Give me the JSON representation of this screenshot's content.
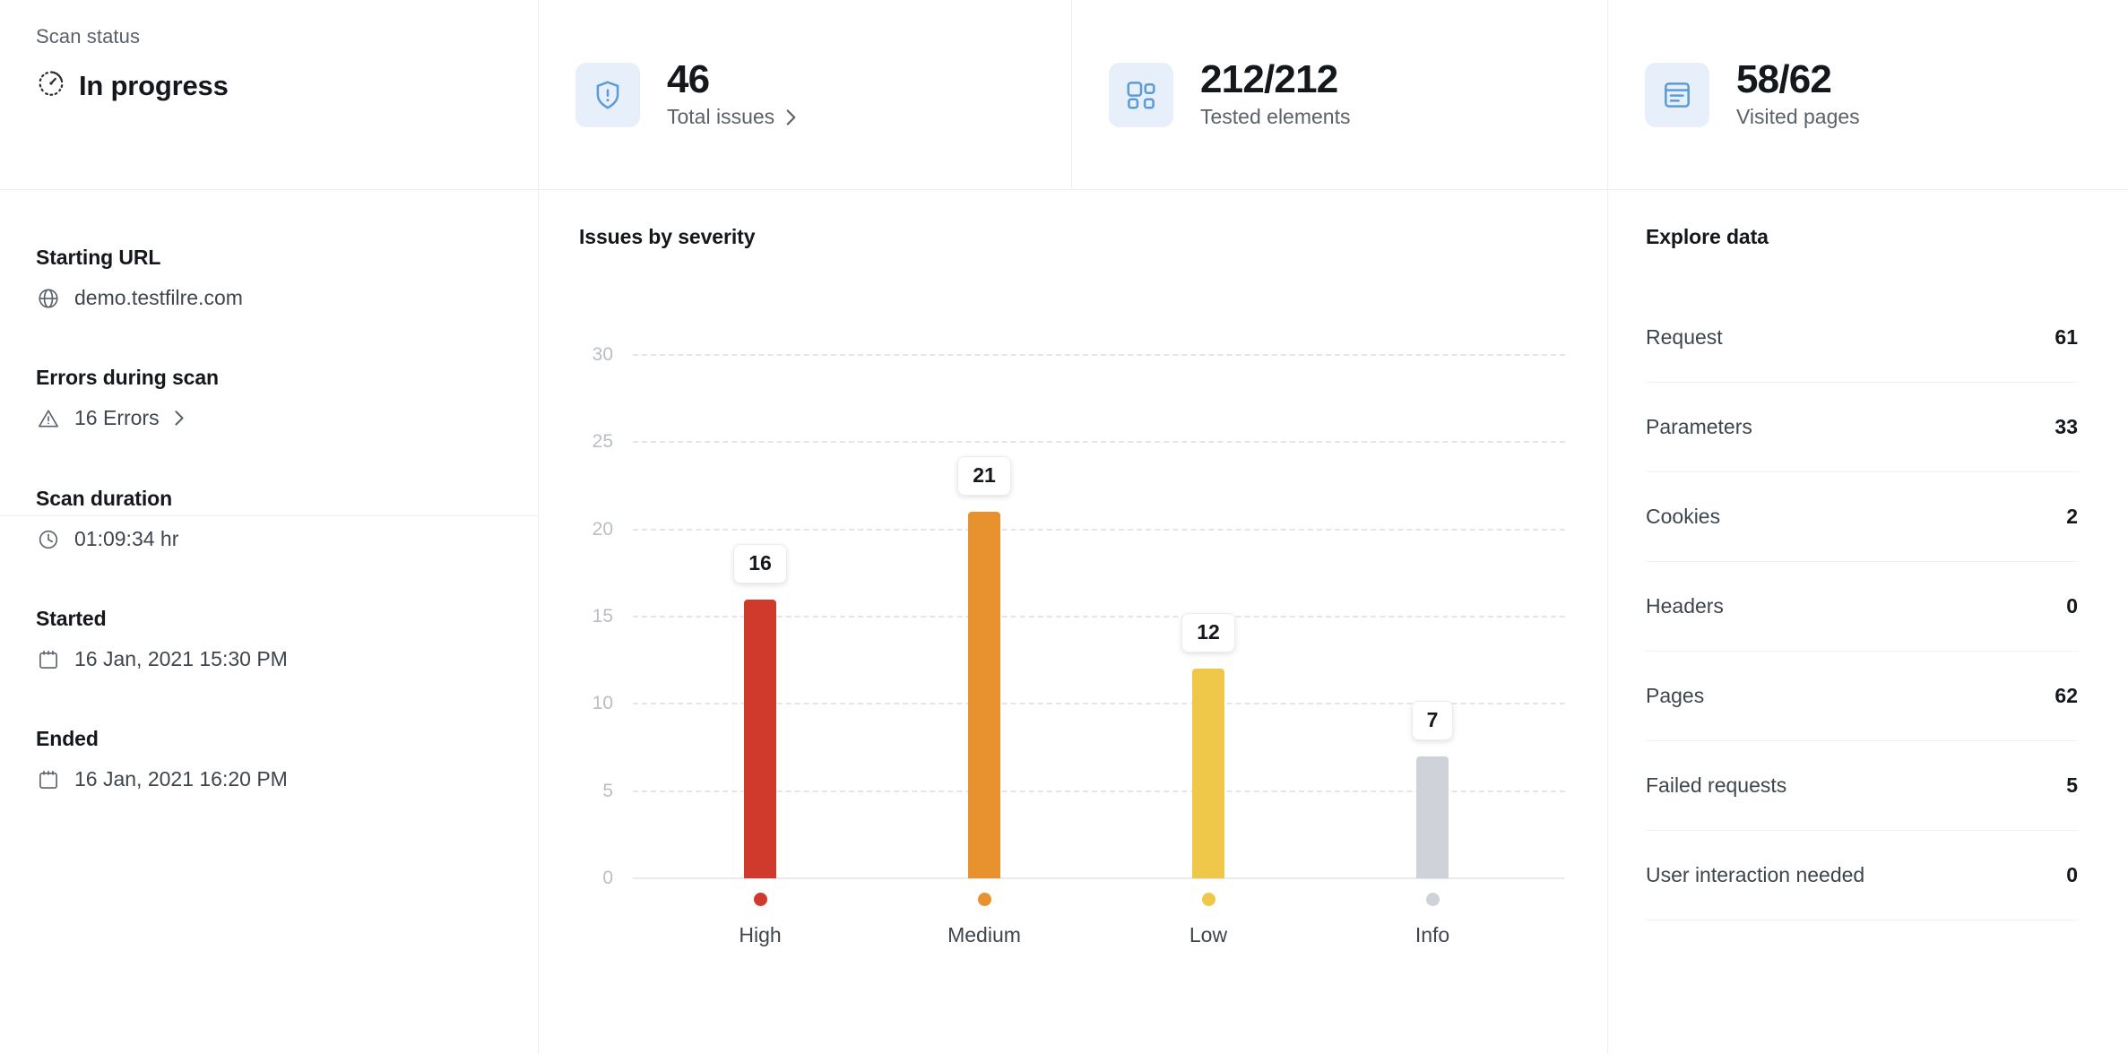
{
  "status_card": {
    "label": "Scan status",
    "value": "In progress",
    "icon": "gauge-in-progress-icon"
  },
  "stat_cards": [
    {
      "icon": "shield-alert-icon",
      "value": "46",
      "caption": "Total issues",
      "has_chevron": true
    },
    {
      "icon": "elements-blocks-icon",
      "value": "212/212",
      "caption": "Tested elements",
      "has_chevron": false
    },
    {
      "icon": "page-document-icon",
      "value": "58/62",
      "caption": "Visited pages",
      "has_chevron": false
    }
  ],
  "sidebar": {
    "groups": [
      {
        "blocks": [
          {
            "title": "Starting URL",
            "icon": "globe-icon",
            "value": "demo.testfilre.com",
            "has_chevron": false
          },
          {
            "title": "Errors during scan",
            "icon": "warning-triangle-icon",
            "value": "16 Errors",
            "has_chevron": true
          }
        ]
      },
      {
        "blocks": [
          {
            "title": "Scan duration",
            "icon": "clock-icon",
            "value": "01:09:34 hr",
            "has_chevron": false
          },
          {
            "title": "Started",
            "icon": "calendar-icon",
            "value": "16 Jan, 2021 15:30 PM",
            "has_chevron": false
          },
          {
            "title": "Ended",
            "icon": "calendar-icon",
            "value": "16 Jan, 2021 16:20 PM",
            "has_chevron": false
          }
        ]
      }
    ]
  },
  "chart_data": {
    "type": "bar",
    "title": "Issues by severity",
    "xlabel": "",
    "ylabel": "",
    "categories": [
      "High",
      "Medium",
      "Low",
      "Info"
    ],
    "values": [
      16,
      21,
      12,
      7
    ],
    "colors": [
      "#D03A2C",
      "#E8922F",
      "#EFC84A",
      "#CFD3D9"
    ],
    "yticks": [
      30,
      25,
      20,
      15,
      10,
      5,
      0
    ],
    "ylim": [
      0,
      30
    ],
    "grid": true,
    "grid_style": "dashed-horizontal",
    "data_labels": [
      "16",
      "21",
      "12",
      "7"
    ],
    "legend": "below-axis-dots"
  },
  "explore": {
    "title": "Explore data",
    "rows": [
      {
        "key": "Request",
        "value": "61"
      },
      {
        "key": "Parameters",
        "value": "33"
      },
      {
        "key": "Cookies",
        "value": "2"
      },
      {
        "key": "Headers",
        "value": "0"
      },
      {
        "key": "Pages",
        "value": "62"
      },
      {
        "key": "Failed requests",
        "value": "5"
      },
      {
        "key": "User interaction needed",
        "value": "0"
      }
    ]
  }
}
